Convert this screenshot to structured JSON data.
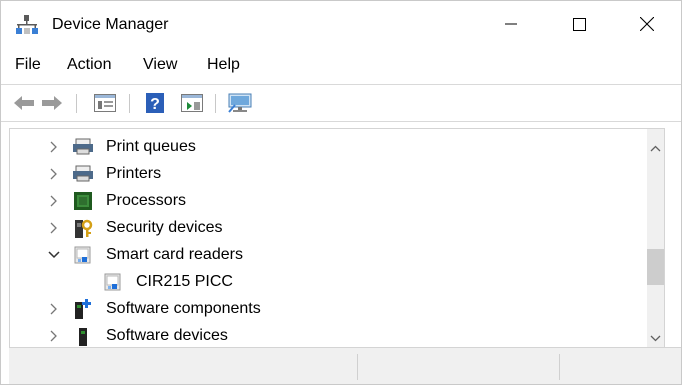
{
  "window": {
    "title": "Device Manager"
  },
  "menu": {
    "items": [
      "File",
      "Action",
      "View",
      "Help"
    ]
  },
  "toolbar": {
    "buttons": [
      "back-arrow-icon",
      "forward-arrow-icon",
      "properties-icon",
      "help-icon",
      "update-driver-icon",
      "scan-hardware-icon"
    ]
  },
  "tree": {
    "items": [
      {
        "label": "Print queues",
        "expanded": false,
        "icon": "printer-icon"
      },
      {
        "label": "Printers",
        "expanded": false,
        "icon": "printer-icon"
      },
      {
        "label": "Processors",
        "expanded": false,
        "icon": "chip-icon"
      },
      {
        "label": "Security devices",
        "expanded": false,
        "icon": "security-key-icon"
      },
      {
        "label": "Smart card readers",
        "expanded": true,
        "icon": "smart-card-reader-icon"
      },
      {
        "label": "CIR215 PICC",
        "child": true,
        "icon": "smart-card-reader-icon"
      },
      {
        "label": "Software components",
        "expanded": false,
        "icon": "software-component-icon"
      },
      {
        "label": "Software devices",
        "expanded": false,
        "icon": "software-device-icon"
      }
    ]
  },
  "colors": {
    "accent_blue": "#1e6fd9",
    "chip_green": "#3c8c3c",
    "thumb": "#cdcdcd"
  }
}
